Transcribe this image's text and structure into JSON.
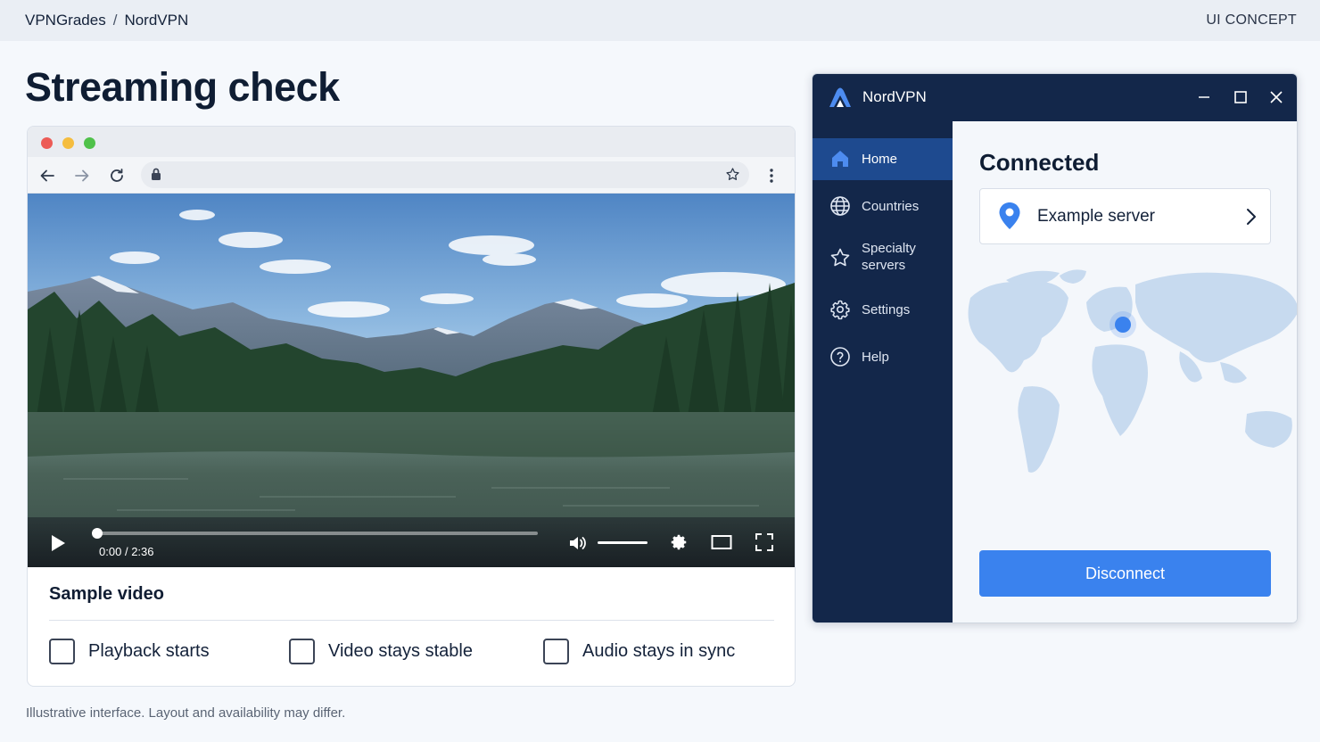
{
  "topbar": {
    "breadcrumb": [
      "VPNGrades",
      "NordVPN"
    ],
    "breadcrumb_separator": "/",
    "concept_label": "UI CONCEPT"
  },
  "page": {
    "title": "Streaming check",
    "footnote": "Illustrative interface. Layout and availability may differ."
  },
  "browser": {
    "traffic_lights": [
      "#ec5b56",
      "#f5bd3f",
      "#4fc14a"
    ],
    "toolbar_icons": [
      "back-arrow-icon",
      "forward-arrow-icon",
      "reload-icon",
      "lock-icon",
      "star-icon",
      "more-vertical-icon"
    ],
    "address_value": "",
    "video": {
      "current_time": "0:00",
      "duration": "2:36",
      "time_separator": "/",
      "progress_fraction": 0.0,
      "volume_fraction": 1.0
    },
    "sample_title": "Sample video",
    "checklist": [
      {
        "label": "Playback starts",
        "checked": false
      },
      {
        "label": "Video stays stable",
        "checked": false
      },
      {
        "label": "Audio stays in sync",
        "checked": false
      }
    ]
  },
  "vpn": {
    "app_title": "NordVPN",
    "window_controls": [
      "minimize-icon",
      "maximize-icon",
      "close-icon"
    ],
    "sidebar": [
      {
        "label": "Home",
        "icon": "home-icon",
        "active": true
      },
      {
        "label": "Countries",
        "icon": "globe-icon",
        "active": false
      },
      {
        "label": "Specialty servers",
        "icon": "star-icon",
        "active": false
      },
      {
        "label": "Settings",
        "icon": "gear-icon",
        "active": false
      },
      {
        "label": "Help",
        "icon": "help-icon",
        "active": false
      }
    ],
    "status": "Connected",
    "server_name": "Example server",
    "disconnect_label": "Disconnect",
    "colors": {
      "sidebar_bg": "#13274a",
      "active_item": "#1e4a8f",
      "accent": "#3a82ee"
    }
  }
}
